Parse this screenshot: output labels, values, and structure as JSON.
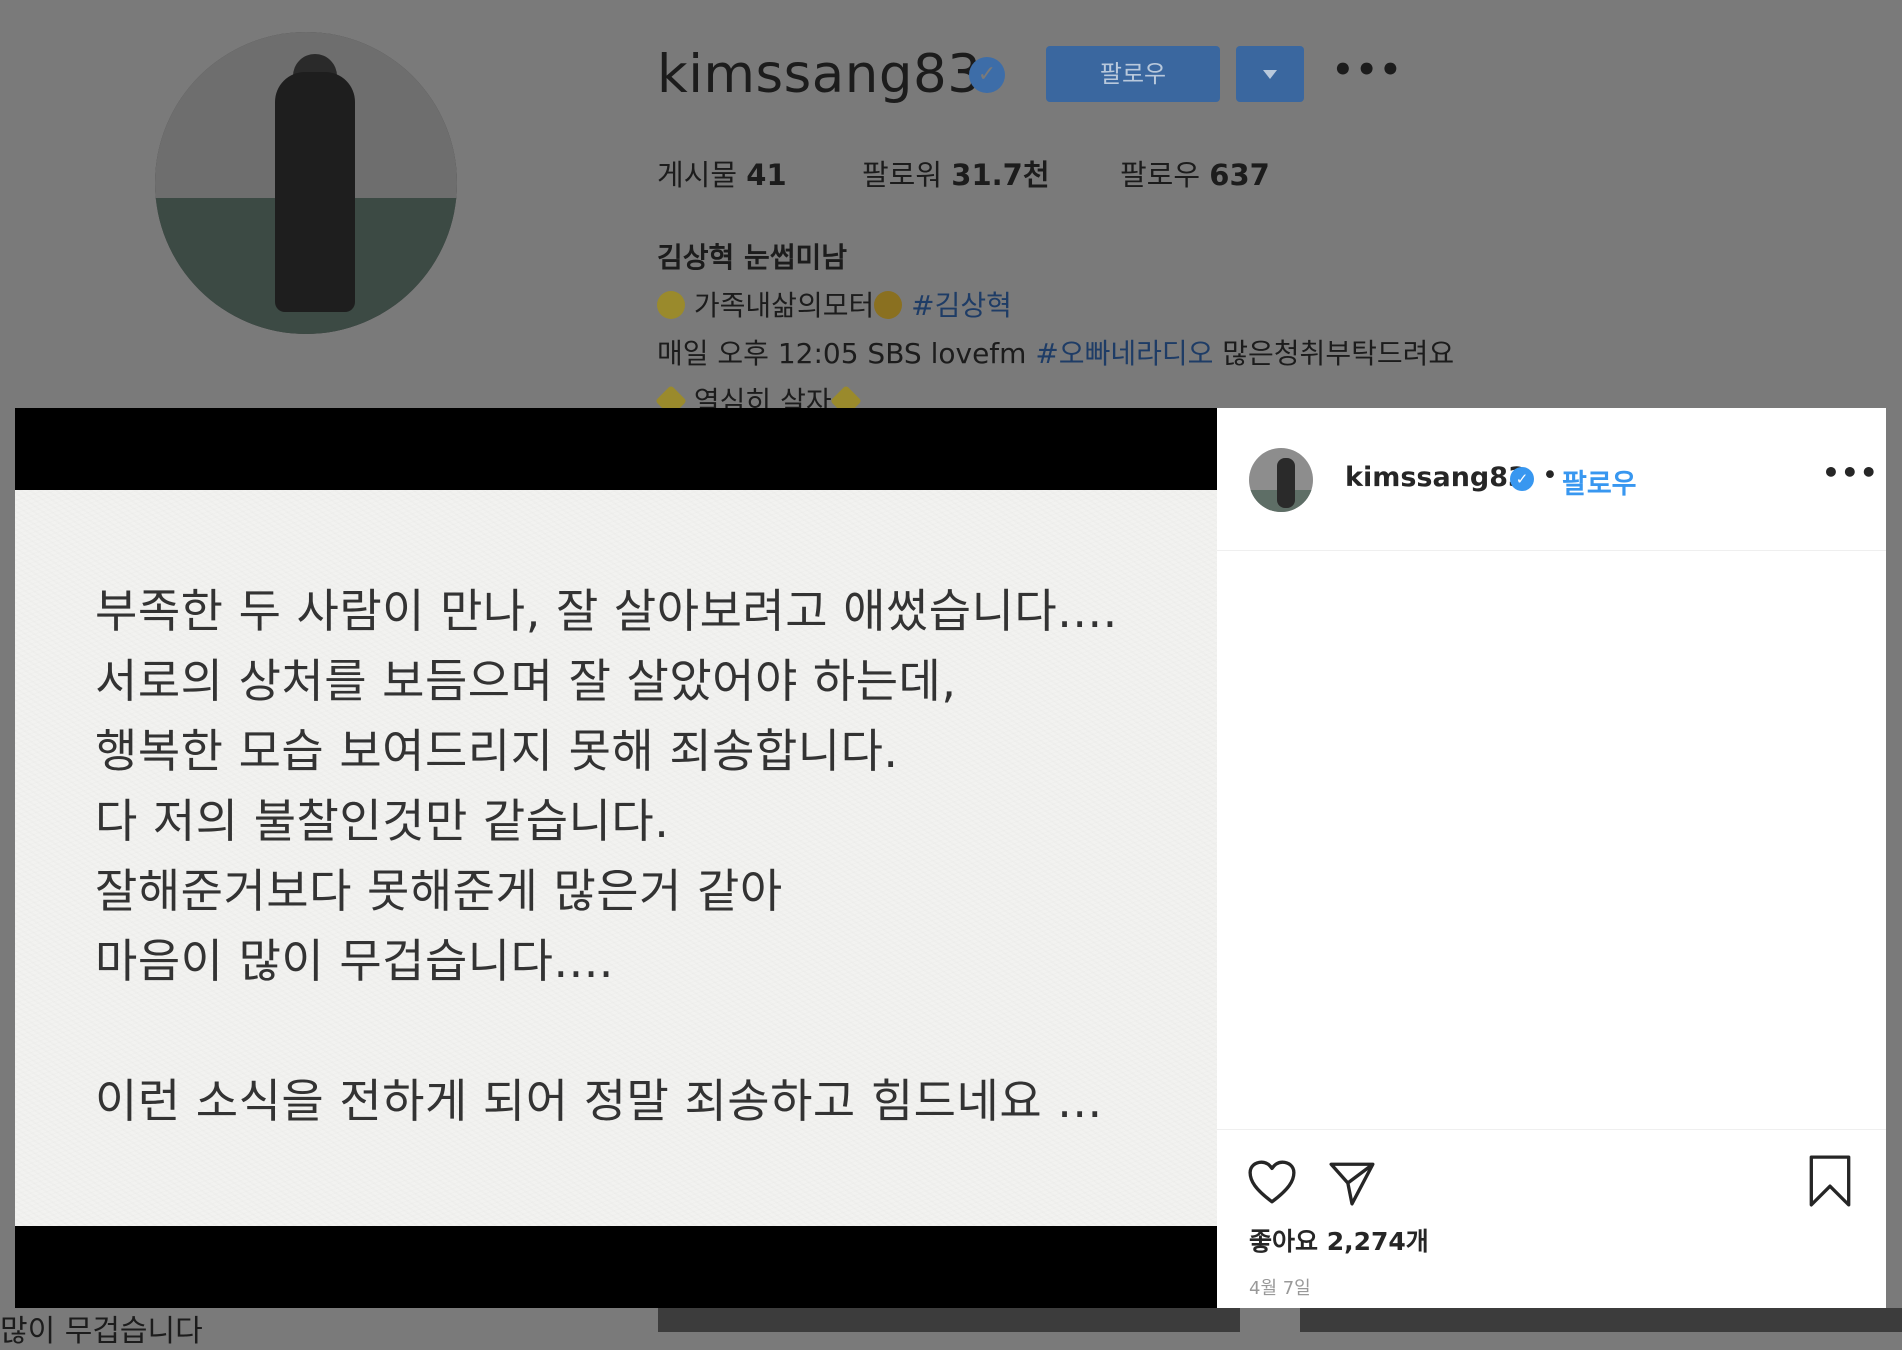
{
  "profile": {
    "username": "kimssang83",
    "follow_label": "팔로우",
    "stats": [
      {
        "label": "게시물",
        "value": "41"
      },
      {
        "label": "팔로워",
        "value": "31.7천"
      },
      {
        "label": "팔로우",
        "value": "637"
      }
    ],
    "bio": {
      "name": "김상혁 눈썹미남",
      "line1_text": "가족내삶의모터",
      "line1_tag": "#김상혁",
      "line2_prefix": "매일 오후 12:05 SBS lovefm ",
      "line2_tag": "#오빠네라디오",
      "line2_suffix": " 많은청취부탁드려요",
      "line3_text": "열심히 살자"
    },
    "bottom_text": "많이 무겁습니다"
  },
  "post": {
    "letter_lines": [
      "부족한 두 사람이 만나, 잘 살아보려고 애썼습니다....",
      "서로의 상처를 보듬으며 잘 살았어야 하는데,",
      "행복한 모습 보여드리지 못해 죄송합니다.",
      "다 저의 불찰인것만 같습니다.",
      "잘해준거보다 못해준게 많은거 같아",
      "마음이 많이 무겁습니다....",
      "",
      "이런 소식을 전하게 되어 정말 죄송하고 힘드네요 ..."
    ],
    "author": "kimssang83",
    "dot": "•",
    "follow_label": "팔로우",
    "likes": "좋아요 2,274개",
    "date": "4월 7일"
  },
  "icons": [
    "verified-icon",
    "chevron-down-icon",
    "more-icon",
    "heart-icon",
    "share-icon",
    "bookmark-icon"
  ],
  "colors": {
    "accent": "#3897f0",
    "overlay": "#7a7a7a"
  }
}
